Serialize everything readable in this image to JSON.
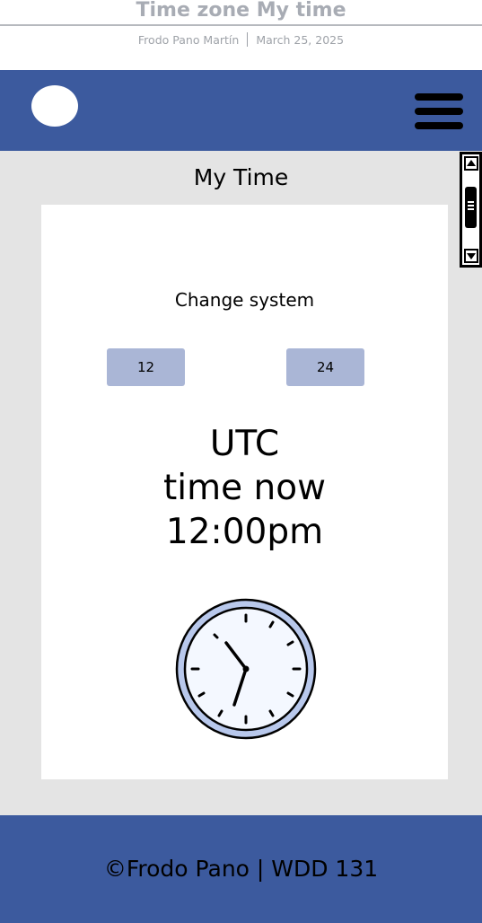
{
  "doc": {
    "title": "Time zone My time",
    "author": "Frodo Pano Martín",
    "date": "March 25, 2025"
  },
  "nav": {
    "logo_icon": "circle-logo-icon",
    "menu_icon": "hamburger-menu-icon"
  },
  "main": {
    "title": "My Time",
    "change_label": "Change system",
    "buttons": {
      "twelve": "12",
      "twentyfour": "24"
    },
    "time": {
      "zone": "UTC",
      "label": "time now",
      "value": "12:00pm"
    },
    "clock_icon": "analog-clock-icon"
  },
  "footer": {
    "text": "©Frodo Pano | WDD 131"
  },
  "colors": {
    "brand": "#3c5a9e",
    "button": "#aab6d6",
    "background": "#e4e4e4",
    "clock_ring": "#b8c8ec",
    "clock_face": "#f4f8ff"
  }
}
